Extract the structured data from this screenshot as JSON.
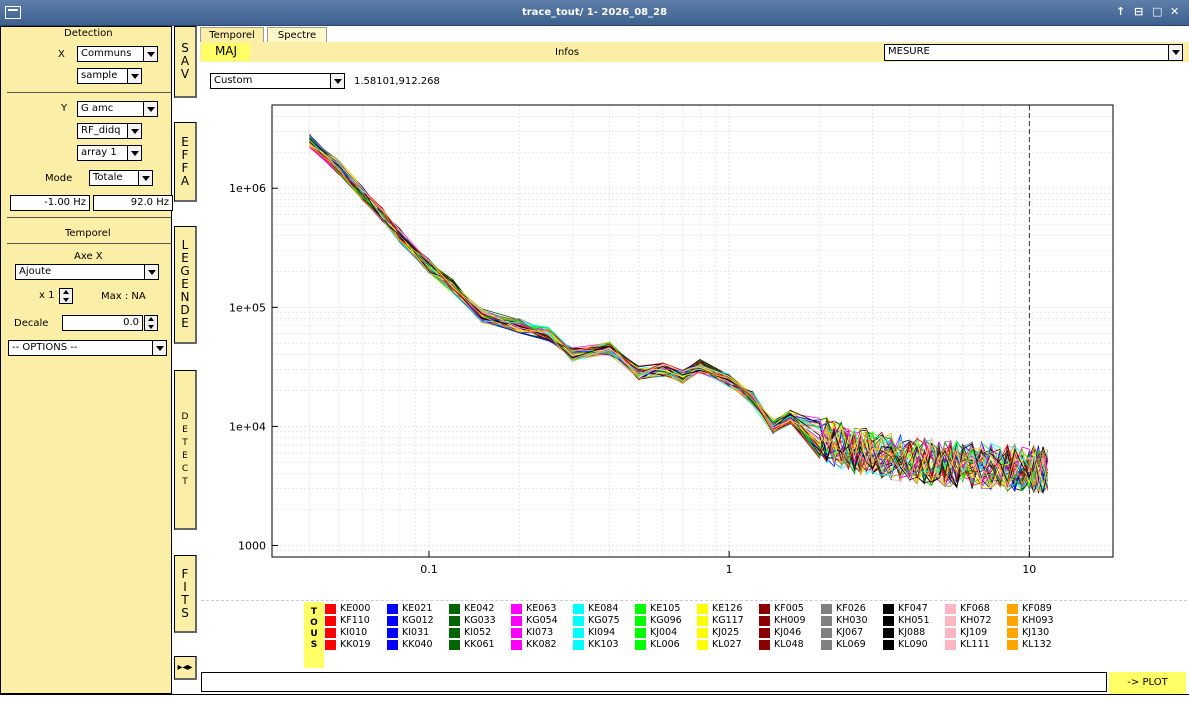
{
  "window": {
    "title": "trace_tout/ 1- 2026_08_28",
    "buttons": [
      "↑",
      "⊟",
      "□",
      "✕"
    ]
  },
  "left": {
    "detection_title": "Detection",
    "x_label": "X",
    "x_combo1": "Communs",
    "x_combo2": "sample",
    "y_label": "Y",
    "y_combo1": "G amc",
    "y_combo2": "RF_didq",
    "y_combo3": "array 1",
    "mode_label": "Mode",
    "mode_value": "Totale",
    "freq_min": "-1.00 Hz",
    "freq_max": "92.0 Hz",
    "temporel_title": "Temporel",
    "axe_x_label": "Axe X",
    "axe_x_value": "Ajoute",
    "mult_value": "x 1",
    "max_label": "Max : NA",
    "decale_label": "Decale",
    "decale_value": "0.0",
    "options_value": "-- OPTIONS --"
  },
  "side_buttons": [
    {
      "name": "sav",
      "letters": [
        "S",
        "A",
        "V"
      ]
    },
    {
      "name": "effa",
      "letters": [
        "E",
        "F",
        "F",
        "A"
      ]
    },
    {
      "name": "legende",
      "letters": [
        "L",
        "E",
        "G",
        "E",
        "N",
        "D",
        "E"
      ]
    },
    {
      "name": "detect",
      "letters": [
        "D",
        "E",
        "T",
        "E",
        "C",
        "T"
      ]
    },
    {
      "name": "fits",
      "letters": [
        "F",
        "I",
        "T",
        "S"
      ]
    }
  ],
  "tabs": {
    "temporel": "Temporel",
    "spectre": "Spectre"
  },
  "toolbar": {
    "maj": "MAJ",
    "infos": "Infos",
    "mesure": "MESURE"
  },
  "plot": {
    "scale_combo": "Custom",
    "cursor_readout": "1.58101,912.268"
  },
  "chart_data": {
    "type": "line",
    "x_scale": "log",
    "y_scale": "log",
    "xlim": [
      0.03,
      19
    ],
    "ylim": [
      800,
      5000000
    ],
    "x_ticks": [
      "0.1",
      "1",
      "10"
    ],
    "y_ticks": [
      "1000",
      "1e+04",
      "1e+05",
      "1e+06"
    ],
    "grid": true,
    "vline_x": 10,
    "base_x": [
      0.04,
      0.05,
      0.06,
      0.07,
      0.08,
      0.1,
      0.12,
      0.15,
      0.2,
      0.25,
      0.3,
      0.4,
      0.5,
      0.6,
      0.7,
      0.8,
      1.0,
      1.2,
      1.4,
      1.6,
      2.0,
      2.5,
      3.0,
      4.0,
      5.0,
      6.0,
      8.0,
      10.0,
      11.5
    ],
    "base_y": [
      2500000,
      1500000,
      900000,
      600000,
      400000,
      220000,
      150000,
      85000,
      70000,
      60000,
      40000,
      45000,
      28000,
      30000,
      26000,
      32000,
      24000,
      17000,
      10000,
      12000,
      8000,
      6500,
      6000,
      5200,
      5000,
      4800,
      4600,
      4400,
      4300
    ]
  },
  "legend": {
    "tous": [
      "T",
      "O",
      "U",
      "S"
    ],
    "columns": [
      {
        "color": "#ff0000",
        "items": [
          "KE000",
          "KF110",
          "KI010",
          "KK019"
        ]
      },
      {
        "color": "#0000ff",
        "items": [
          "KE021",
          "KG012",
          "KI031",
          "KK040"
        ]
      },
      {
        "color": "#006400",
        "items": [
          "KE042",
          "KG033",
          "KI052",
          "KK061"
        ]
      },
      {
        "color": "#ff00ff",
        "items": [
          "KE063",
          "KG054",
          "KI073",
          "KK082"
        ]
      },
      {
        "color": "#00ffff",
        "items": [
          "KE084",
          "KG075",
          "KI094",
          "KK103"
        ]
      },
      {
        "color": "#00ff00",
        "items": [
          "KE105",
          "KG096",
          "KJ004",
          "KL006"
        ]
      },
      {
        "color": "#ffff00",
        "items": [
          "KE126",
          "KG117",
          "KJ025",
          "KL027"
        ]
      },
      {
        "color": "#8b0000",
        "items": [
          "KF005",
          "KH009",
          "KJ046",
          "KL048"
        ]
      },
      {
        "color": "#808080",
        "items": [
          "KF026",
          "KH030",
          "KJ067",
          "KL069"
        ]
      },
      {
        "color": "#000000",
        "items": [
          "KF047",
          "KH051",
          "KJ088",
          "KL090"
        ]
      },
      {
        "color": "#ffb6c1",
        "items": [
          "KF068",
          "KH072",
          "KJ109",
          "KL111"
        ]
      },
      {
        "color": "#ffa500",
        "items": [
          "KF089",
          "KH093",
          "KJ130",
          "KL132"
        ]
      }
    ]
  },
  "bottom": {
    "plot_button": "-> PLOT",
    "nav_icon": "▸◂▸"
  }
}
